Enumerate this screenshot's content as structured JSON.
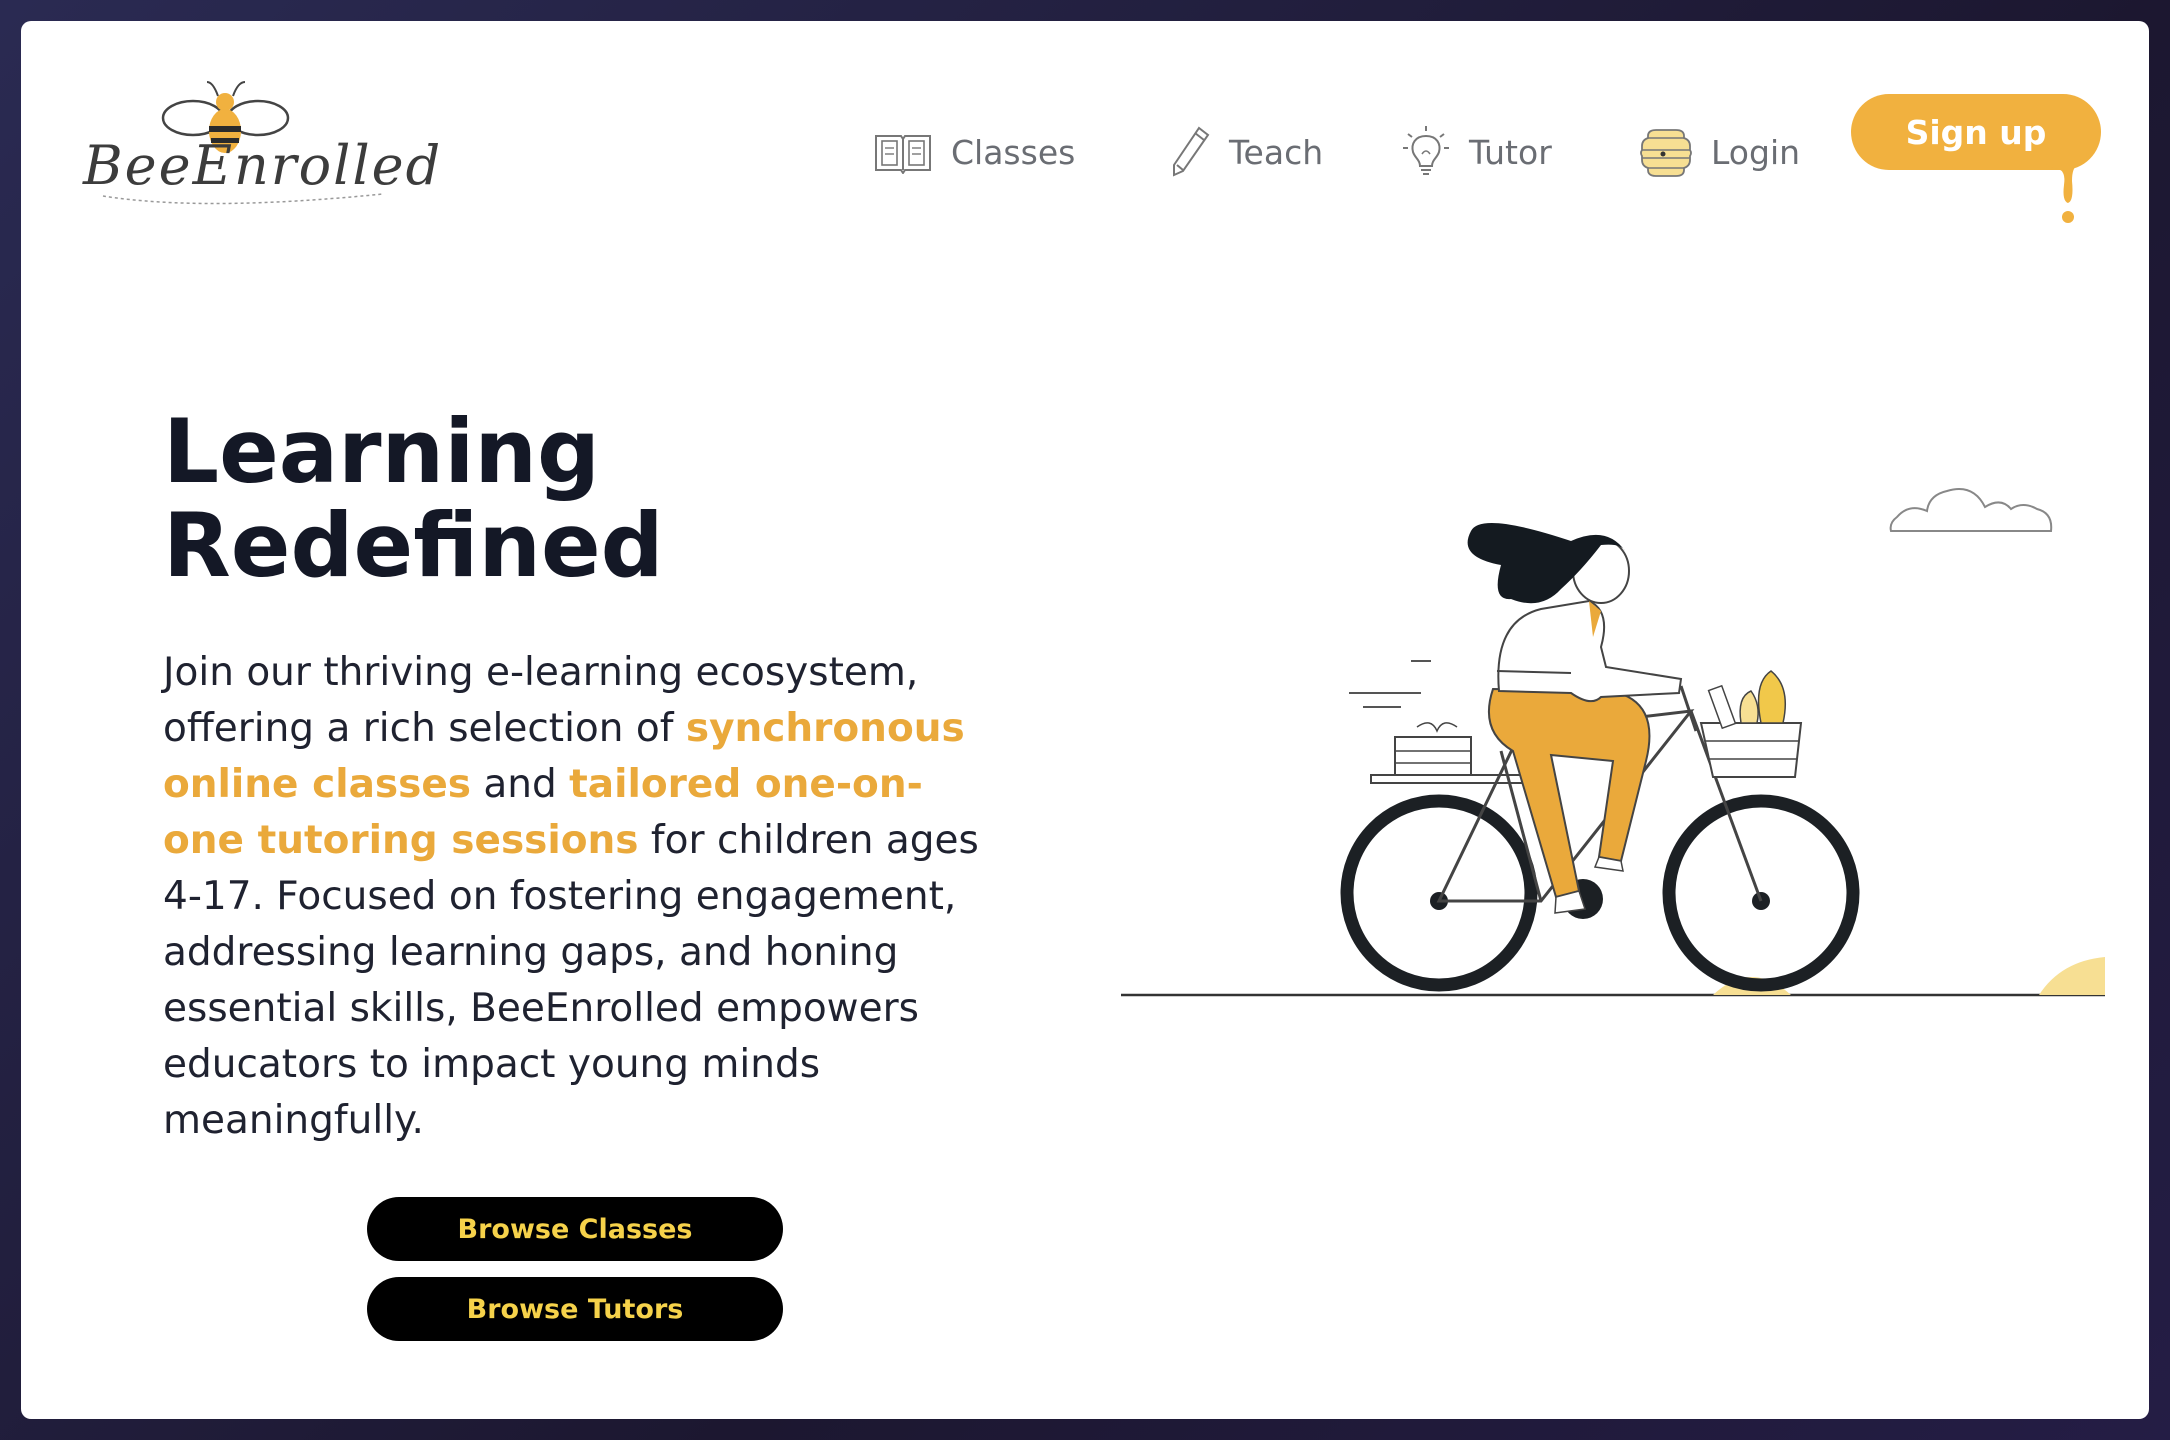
{
  "brand": {
    "logo_text": "BeeEnrolled"
  },
  "nav": {
    "classes": "Classes",
    "teach": "Teach",
    "tutor": "Tutor",
    "login": "Login",
    "signup": "Sign up"
  },
  "hero": {
    "title_line1": "Learning",
    "title_line2": "Redefined",
    "desc_part1": "Join our thriving e-learning ecosystem, offering a rich selection of ",
    "desc_highlight1": "synchronous online classes",
    "desc_part2": " and ",
    "desc_highlight2": "tailored one-on-one tutoring sessions",
    "desc_part3": " for children ages 4-17. Focused on fostering engagement, addressing learning gaps, and honing essential skills, BeeEnrolled empowers educators to impact young minds meaningfully."
  },
  "buttons": {
    "browse_classes": "Browse Classes",
    "browse_tutors": "Browse Tutors"
  },
  "icons": {
    "classes": "book-icon",
    "teach": "pencil-icon",
    "tutor": "lightbulb-icon",
    "login": "beehive-icon"
  },
  "colors": {
    "accent": "#f1b13f",
    "highlight": "#eaa93b",
    "button_bg": "#000000",
    "button_text": "#f6d24a",
    "heading": "#141826"
  }
}
